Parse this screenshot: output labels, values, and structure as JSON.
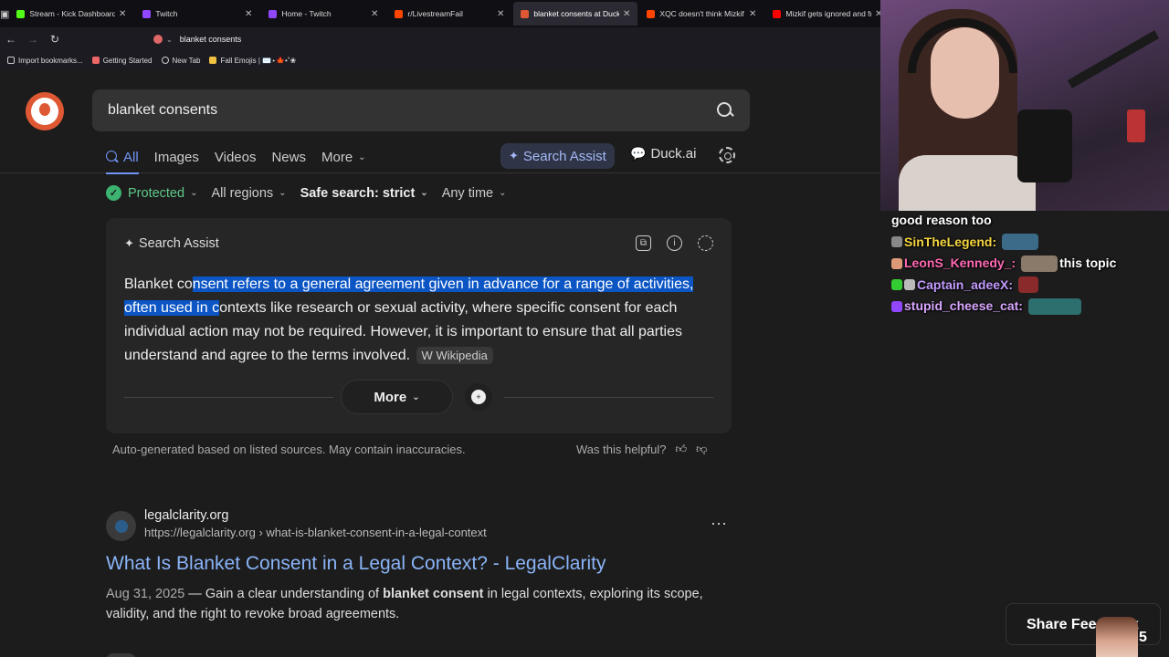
{
  "tabs": [
    {
      "label": "Stream - Kick Dashboard",
      "favicon_color": "#53fc18",
      "active": false
    },
    {
      "label": "Twitch",
      "favicon_color": "#9146ff",
      "active": false
    },
    {
      "label": "Home - Twitch",
      "favicon_color": "#9146ff",
      "active": false
    },
    {
      "label": "r/LivestreamFail",
      "favicon_color": "#ff4500",
      "active": false
    },
    {
      "label": "blanket consents at DuckD",
      "favicon_color": "#de5833",
      "active": true
    },
    {
      "label": "XQC doesn't think Mizkif is",
      "favicon_color": "#ff4500",
      "active": false
    },
    {
      "label": "Mizkif gets ignored and fre",
      "favicon_color": "#ff0000",
      "active": false
    }
  ],
  "address_bar": {
    "url": "blanket consents"
  },
  "bookmarks": [
    {
      "label": "Import bookmarks...",
      "icon": "import-icon"
    },
    {
      "label": "Getting Started",
      "icon": "getting-started-icon"
    },
    {
      "label": "New Tab",
      "icon": "globe-icon"
    },
    {
      "label": "Fall Emojis | ✉️⋆🍁•˚❀",
      "icon": "folder-icon"
    }
  ],
  "search": {
    "query": "blanket consents"
  },
  "nav_tabs": [
    {
      "label": "All",
      "active": true
    },
    {
      "label": "Images",
      "active": false
    },
    {
      "label": "Videos",
      "active": false
    },
    {
      "label": "News",
      "active": false
    },
    {
      "label": "More",
      "active": false
    }
  ],
  "search_assist_label": "Search Assist",
  "duckai_label": "Duck.ai",
  "filters": {
    "protected": "Protected",
    "regions": "All regions",
    "safe_search": "Safe search: strict",
    "time": "Any time"
  },
  "assist": {
    "title": "Search Assist",
    "text_pre": "Blanket co",
    "text_highlight": "nsent refers to a general agreement given in advance for a range of activities, often used in c",
    "text_post": "ontexts like research or sexual activity, where specific consent for each individual action may not be required. However, it is important to ensure that all parties understand and agree to the terms involved.",
    "source": "Wikipedia",
    "more_label": "More",
    "disclaimer": "Auto-generated based on listed sources. May contain inaccuracies.",
    "helpful": "Was this helpful?"
  },
  "result": {
    "site": "legalclarity.org",
    "url": "https://legalclarity.org › what-is-blanket-consent-in-a-legal-context",
    "title": "What Is Blanket Consent in a Legal Context? - LegalClarity",
    "date": "Aug 31, 2025",
    "snippet_pre": "Gain a clear understanding of ",
    "snippet_bold": "blanket consent",
    "snippet_post": " in legal contexts, exploring its scope, validity, and the right to revoke broad agreements."
  },
  "chat": [
    {
      "user": "",
      "message": "good reason too",
      "color": "#ffffff"
    },
    {
      "user": "SinTheLegend:",
      "message": "",
      "color": "#f5d540"
    },
    {
      "user": "LeonS_Kennedy_:",
      "message": "this topic",
      "color": "#ff69b4"
    },
    {
      "user": "Captain_adeeX:",
      "message": "",
      "color": "#c39bff"
    },
    {
      "user": "stupid_cheese_cat:",
      "message": "",
      "color": "#d9a6ff"
    }
  ],
  "share": {
    "label": "Share Feedback",
    "count": "5"
  },
  "colors": {
    "accent": "#7295f6",
    "highlight": "#0b55c4",
    "link": "#8ab4f8",
    "protected": "#3cb371"
  }
}
